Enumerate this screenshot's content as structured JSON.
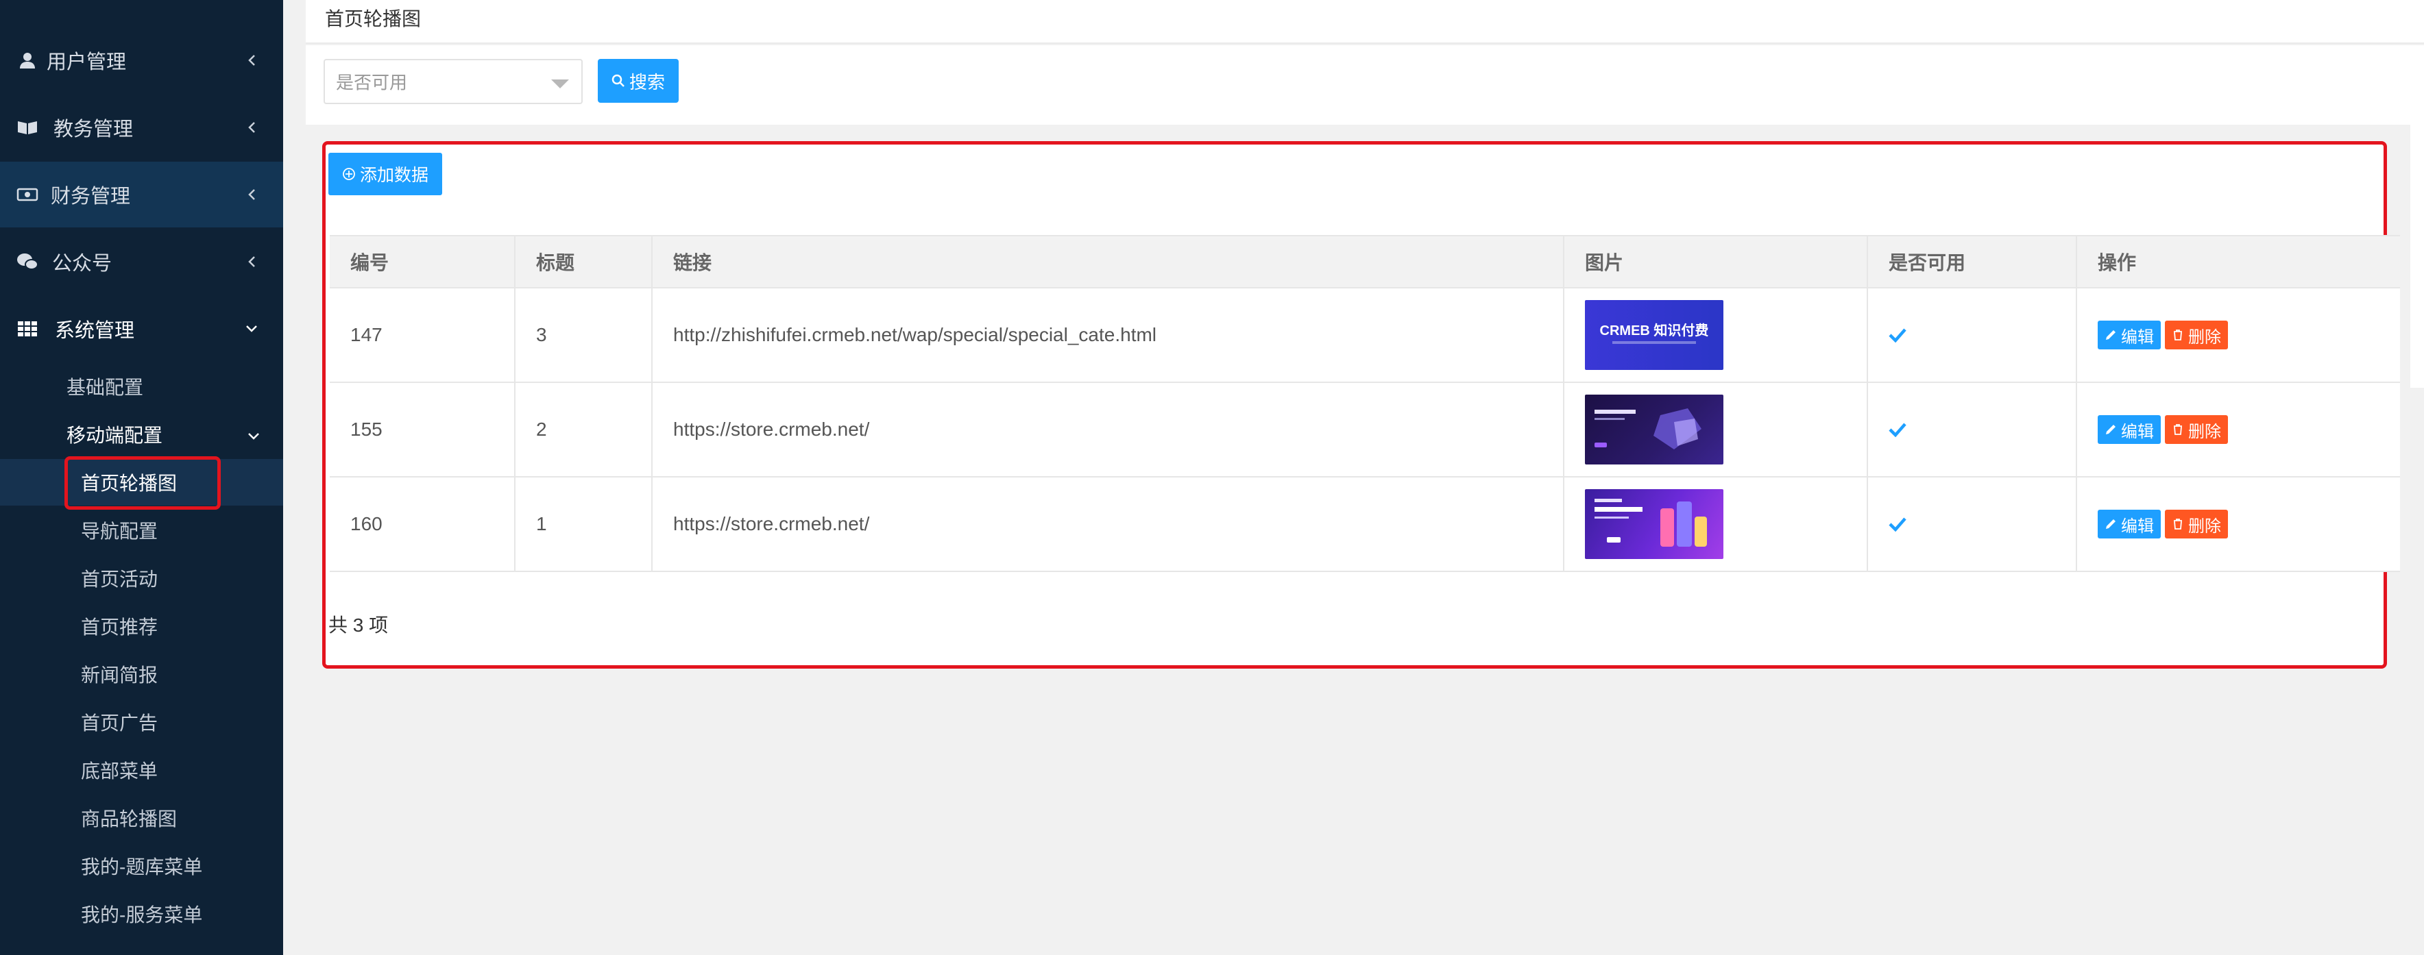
{
  "sidebar": {
    "menu": [
      {
        "label": "用户管理",
        "icon": "user-icon"
      },
      {
        "label": "教务管理",
        "icon": "book-icon"
      },
      {
        "label": "财务管理",
        "icon": "money-icon"
      },
      {
        "label": "公众号",
        "icon": "wechat-icon"
      },
      {
        "label": "系统管理",
        "icon": "grid-icon"
      }
    ],
    "sub_l1": [
      {
        "label": "基础配置"
      },
      {
        "label": "移动端配置"
      }
    ],
    "sub_l2": [
      {
        "label": "首页轮播图",
        "active": true
      },
      {
        "label": "导航配置"
      },
      {
        "label": "首页活动"
      },
      {
        "label": "首页推荐"
      },
      {
        "label": "新闻简报"
      },
      {
        "label": "首页广告"
      },
      {
        "label": "底部菜单"
      },
      {
        "label": "商品轮播图"
      },
      {
        "label": "我的-题库菜单"
      },
      {
        "label": "我的-服务菜单"
      }
    ]
  },
  "page": {
    "title": "首页轮播图"
  },
  "filter": {
    "select_placeholder": "是否可用",
    "search_label": "搜索"
  },
  "toolbar": {
    "add_label": "添加数据"
  },
  "table": {
    "headers": [
      "编号",
      "标题",
      "链接",
      "图片",
      "是否可用",
      "操作"
    ],
    "rows": [
      {
        "id": "147",
        "title": "3",
        "link": "http://zhishifufei.crmeb.net/wap/special/special_cate.html",
        "image_text": "CRMEB 知识付费",
        "enabled": true
      },
      {
        "id": "155",
        "title": "2",
        "link": "https://store.crmeb.net/",
        "image_text": "",
        "enabled": true
      },
      {
        "id": "160",
        "title": "1",
        "link": "https://store.crmeb.net/",
        "image_text": "",
        "enabled": true
      }
    ],
    "edit_label": "编辑",
    "delete_label": "删除",
    "total_label": "共 3 项"
  },
  "colors": {
    "sidebar_bg": "#0e2236",
    "primary": "#1e9fff",
    "danger": "#ff5722",
    "highlight": "#e3141e"
  }
}
